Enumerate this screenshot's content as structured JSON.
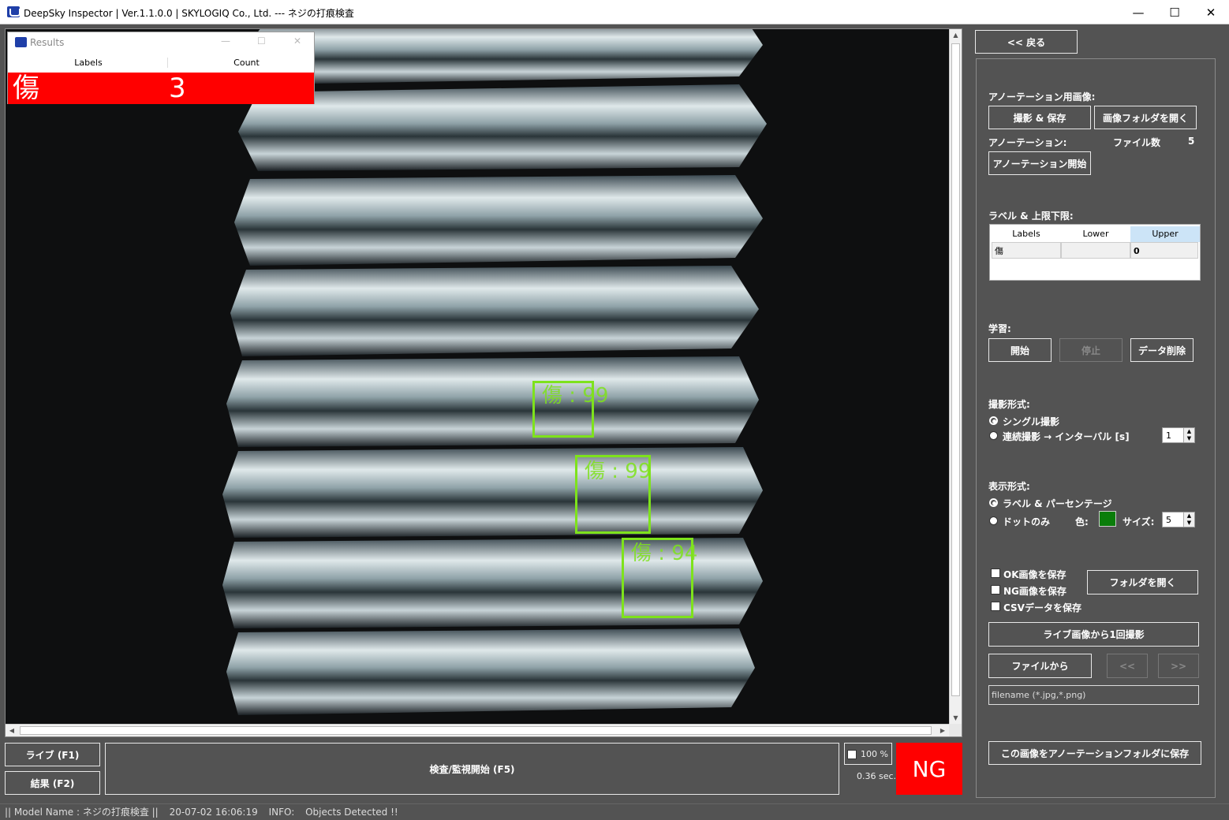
{
  "window": {
    "title": "DeepSky Inspector | Ver.1.1.0.0 | SKYLOGIQ Co., Ltd. --- ネジの打痕検査",
    "minimize": "—",
    "maximize": "☐",
    "close": "✕"
  },
  "results": {
    "title": "Results",
    "col_labels": "Labels",
    "col_count": "Count",
    "row_label": "傷",
    "row_count": "3",
    "highlight_color": "#ff0000"
  },
  "detections": [
    {
      "label": "傷 : 99"
    },
    {
      "label": "傷 : 99"
    },
    {
      "label": "傷 : 94"
    }
  ],
  "detection_color": "#7ee21c",
  "bottom": {
    "live_button": "ライブ (F1)",
    "result_button": "結果 (F2)",
    "inspect_button": "検査/監視開始 (F5)",
    "zoom": "100 %",
    "time": "0.36 sec.",
    "verdict": "NG"
  },
  "panel": {
    "back_button": "<< 戻る",
    "annotation_image_label": "アノーテーション用画像:",
    "capture_save_button": "撮影 & 保存",
    "open_image_folder_button": "画像フォルダを開く",
    "annotation_label": "アノーテーション:",
    "file_count_label": "ファイル数",
    "file_count_value": "5",
    "annotation_start_button": "アノーテーション開始",
    "label_limits_label": "ラベル & 上限下限:",
    "grid": {
      "headers": [
        "Labels",
        "Lower",
        "Upper"
      ],
      "row": [
        "傷",
        "",
        "0"
      ]
    },
    "learning_label": "学習:",
    "start_button": "開始",
    "stop_button": "停止",
    "delete_data_button": "データ削除",
    "capture_mode_label": "撮影形式:",
    "single_capture": "シングル撮影",
    "continuous_capture": "連続撮影 → インターバル [s]",
    "interval_value": "1",
    "display_mode_label": "表示形式:",
    "label_percent": "ラベル & パーセンテージ",
    "dot_only": "ドットのみ",
    "color_label": "色:",
    "size_label": "サイズ:",
    "size_value": "5",
    "dot_color": "#0a7d0a",
    "save_ok": "OK画像を保存",
    "save_ng": "NG画像を保存",
    "save_csv": "CSVデータを保存",
    "open_folder_button": "フォルダを開く",
    "capture_from_live_button": "ライブ画像から1回撮影",
    "from_file_button": "ファイルから",
    "prev_button": "<<",
    "next_button": ">>",
    "filename_placeholder": "filename (*.jpg,*.png)",
    "save_to_annotation_button": "この画像をアノーテーションフォルダに保存"
  },
  "status": {
    "model": "|| Model Name : ネジの打痕検査 ||",
    "timestamp": "20-07-02 16:06:19",
    "info_label": "INFO:",
    "info_text": "Objects Detected !!"
  }
}
